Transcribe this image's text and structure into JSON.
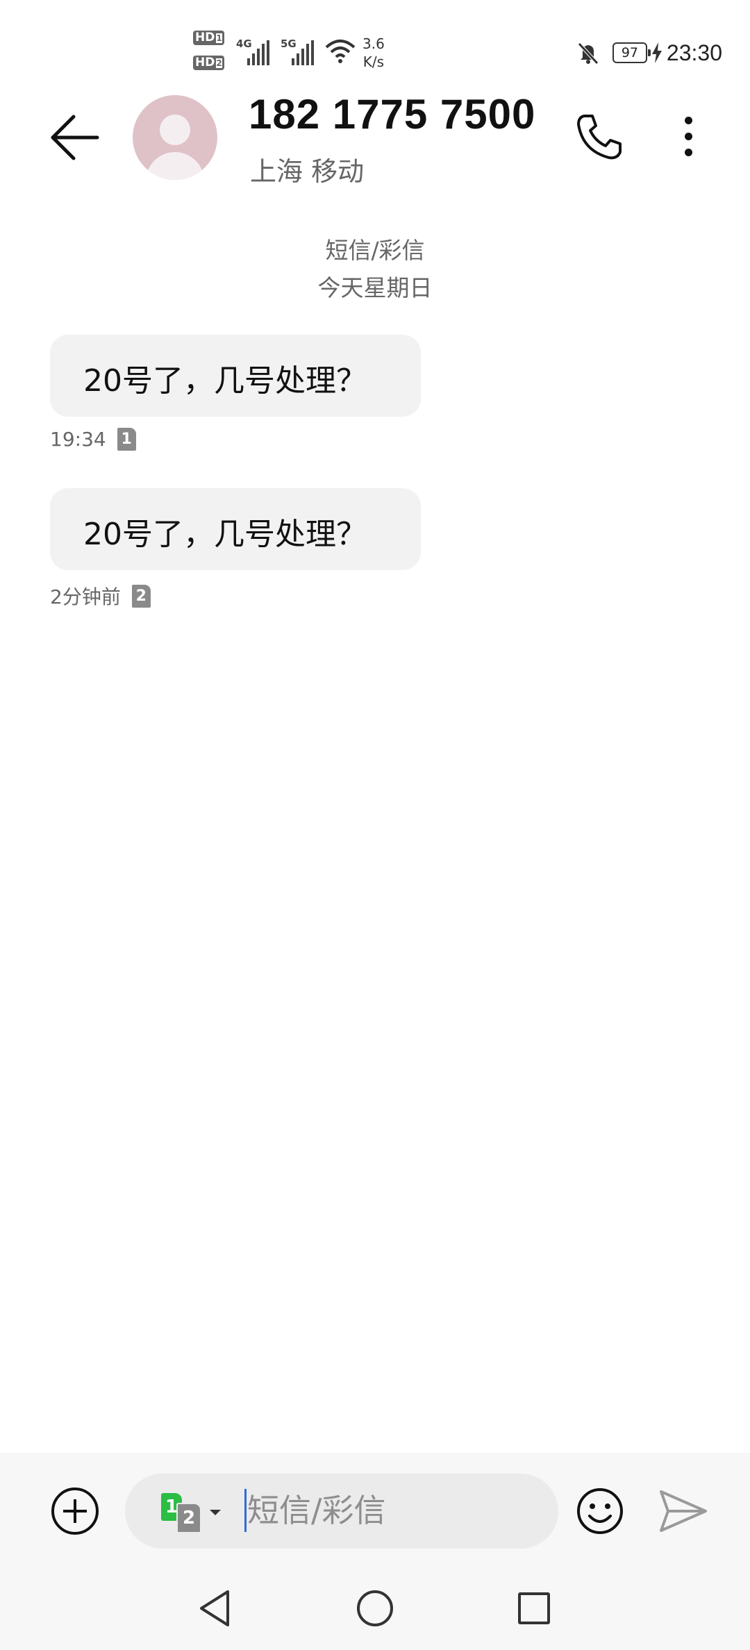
{
  "status_bar": {
    "hd1": "HD",
    "hd1_sub": "1",
    "hd2": "HD",
    "hd2_sub": "2",
    "net1": "4G",
    "net2": "5G",
    "speed_value": "3.6",
    "speed_unit": "K/s",
    "battery": "97",
    "time": "23:30",
    "icons": [
      "signal-icon",
      "wifi-icon",
      "mute-bell-icon",
      "battery-icon",
      "charging-bolt-icon"
    ]
  },
  "header": {
    "contact_number": "182 1775 7500",
    "contact_location": "上海 移动",
    "avatar_color": "#dfc2c8"
  },
  "conversation": {
    "type_label": "短信/彩信",
    "date_label": "今天星期日",
    "messages": [
      {
        "text": "20号了，几号处理？",
        "time": "19:34",
        "sim": "1"
      },
      {
        "text": "20号了，几号处理？",
        "time": "2分钟前",
        "sim": "2"
      }
    ]
  },
  "compose": {
    "placeholder": "短信/彩信",
    "sim_primary": "1",
    "sim_secondary": "2",
    "sim_primary_color": "#2bbd44",
    "cursor_color": "#2f6bd8"
  },
  "nav": {
    "icons": [
      "nav-back-icon",
      "nav-home-icon",
      "nav-recents-icon"
    ]
  }
}
